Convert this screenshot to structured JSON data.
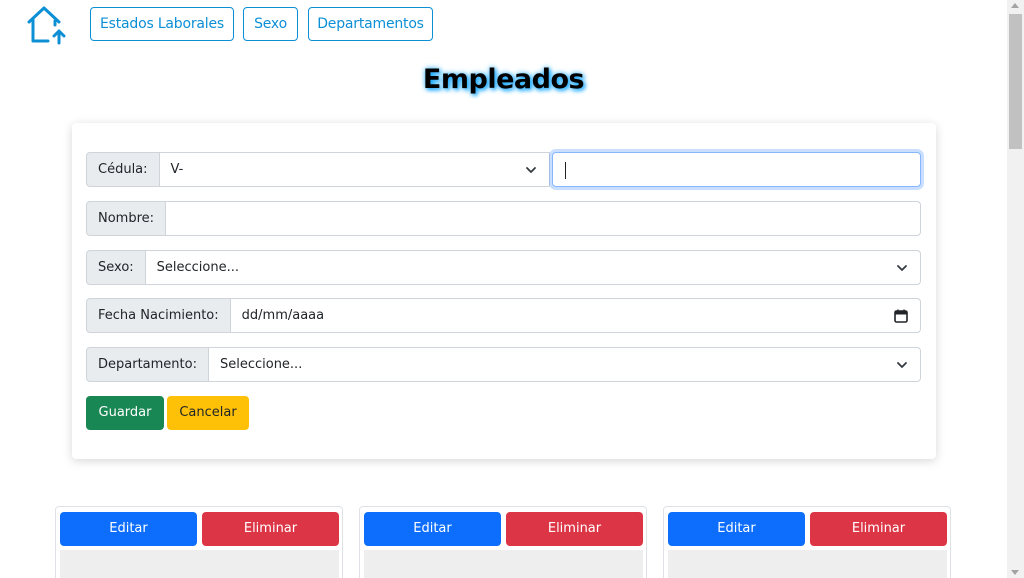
{
  "nav": {
    "home_icon": "home-up-arrow-icon",
    "links": [
      "Estados Laborales",
      "Sexo",
      "Departamentos"
    ]
  },
  "page": {
    "title": "Empleados"
  },
  "form": {
    "cedula": {
      "label": "Cédula:",
      "prefix_value": "V-",
      "number_value": ""
    },
    "nombre": {
      "label": "Nombre:",
      "value": ""
    },
    "sexo": {
      "label": "Sexo:",
      "selected": "Seleccione..."
    },
    "fecha": {
      "label": "Fecha Nacimiento:",
      "value": "dd/mm/aaaa"
    },
    "departamento": {
      "label": "Departamento:",
      "selected": "Seleccione..."
    },
    "buttons": {
      "save": "Guardar",
      "cancel": "Cancelar"
    }
  },
  "employee_cards": [
    {
      "edit": "Editar",
      "delete": "Eliminar"
    },
    {
      "edit": "Editar",
      "delete": "Eliminar"
    },
    {
      "edit": "Editar",
      "delete": "Eliminar"
    }
  ],
  "colors": {
    "accent": "#0d8fd6",
    "primary": "#0d6efd",
    "success": "#198754",
    "warning": "#ffc107",
    "danger": "#dc3545"
  }
}
